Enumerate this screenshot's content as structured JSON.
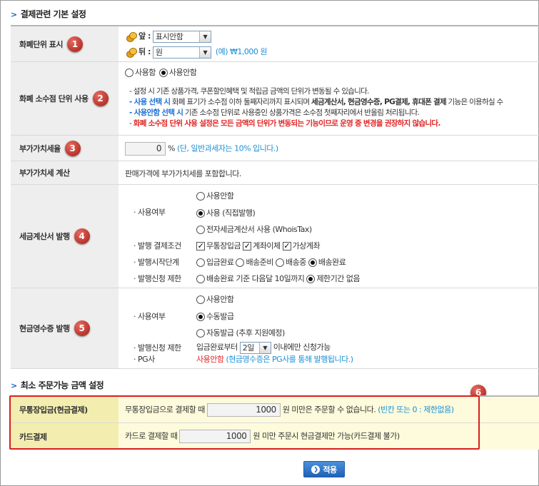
{
  "section1": {
    "title": "결제관련 기본 설정"
  },
  "currency": {
    "label": "화폐단위 표시",
    "badge": "1",
    "front_label": "앞 :",
    "front_value": "표시안함",
    "back_label": "뒤 :",
    "back_value": "원",
    "example": "(예) ₩1,000 원"
  },
  "decimal": {
    "label": "화폐 소수점 단위 사용",
    "badge": "2",
    "opt_use": "사용함",
    "opt_nouse": "사용안함",
    "note1": "- 설정 시 기존 상품가격, 쿠폰할인혜택 및 적립금 금액의 단위가 변동될 수 있습니다.",
    "note2a": "- 사용 선택 시",
    "note2b": " 화폐 표기가 소수점 이하 둘째자리까지 표시되며 ",
    "note2c": "세금계산서, 현금영수증, PG결제, 휴대폰 결제",
    "note2d": " 기능은 이용하실 수",
    "note3a": "- 사용안함 선택 시",
    "note3b": " 기존 소수점 단위로 사용중인 상품가격은 소수점 첫째자리에서 반올림 처리됩니다.",
    "note4a": "- ",
    "note4b": "화폐 소수점 단위 사용 설정은 모든 금액의 단위가 변동되는 기능이므로 운영 중 변경을 권장하지 않습니다."
  },
  "vat": {
    "label": "부가가치세율",
    "badge": "3",
    "value": "0",
    "unit": "%",
    "hint": "(단, 일반과세자는 10% 입니다.)"
  },
  "vatcalc": {
    "label": "부가가치세 계산",
    "text": "판매가격에 부가가치세를 포함합니다."
  },
  "taxinvoice": {
    "label": "세금계산서 발행",
    "badge": "4",
    "use_label": "· 사용여부",
    "opt1": "사용안함",
    "opt2": "사용 (직접발행)",
    "opt3": "전자세금계산서 사용 (WhoisTax)",
    "cond_label": "· 발행 결제조건",
    "cond1": "무통장입금",
    "cond2": "계좌이체",
    "cond3": "가상계좌",
    "start_label": "· 발행시작단계",
    "start1": "입금완료",
    "start2": "배송준비",
    "start3": "배송중",
    "start4": "배송완료",
    "limit_label": "· 발행신청 제한",
    "limit1": "배송완료 기준 다음달 10일까지",
    "limit2": "제한기간 없음"
  },
  "cashreceipt": {
    "label": "현금영수증 발행",
    "badge": "5",
    "use_label": "· 사용여부",
    "opt1": "사용안함",
    "opt2": "수동발급",
    "opt3": "자동발급 (추후 지원예정)",
    "limit_label": "· 발행신청 제한",
    "limit_pre": "입금완료부터",
    "limit_value": "2일",
    "limit_post": "이내에만 신청가능",
    "pg_label": "· PG사",
    "pg_value": "사용안함",
    "pg_note": "(현금영수증은 PG사를 통해 발행됩니다.)"
  },
  "section2": {
    "title": "최소 주문가능 금액 설정",
    "badge": "6"
  },
  "minorder": {
    "bank_label": "무통장입금(현금결제)",
    "bank_pre": "무통장입금으로 결제할 때",
    "bank_value": "1000",
    "bank_post": "원 미만은 주문할 수 없습니다.",
    "bank_hint": "(빈칸 또는 0 : 제한없음)",
    "card_label": "카드결제",
    "card_pre": "카드로 결제할 때",
    "card_value": "1000",
    "card_post": "원 미만 주문시 현금결제만 가능(카드결제 불가)"
  },
  "apply_button": "적용"
}
